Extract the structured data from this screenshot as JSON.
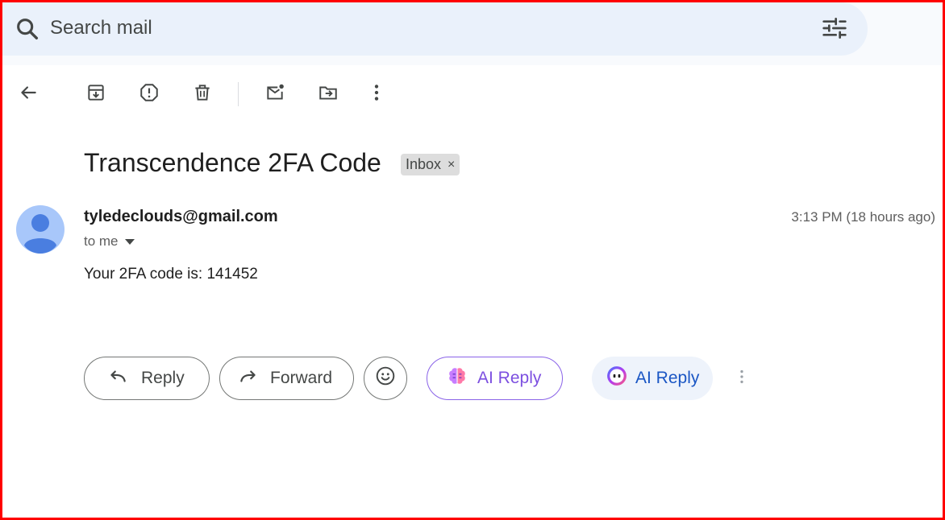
{
  "search": {
    "placeholder": "Search mail"
  },
  "toolbar": {
    "back": "arrow-back-icon",
    "archive": "archive-icon",
    "spam": "report-spam-icon",
    "delete": "delete-icon",
    "mark_unread": "mark-unread-icon",
    "move_to": "move-to-icon",
    "more": "more-vert-icon"
  },
  "email": {
    "subject": "Transcendence 2FA Code",
    "label": "Inbox",
    "label_remove": "×",
    "sender": "tyledeclouds@gmail.com",
    "recipient": "to me",
    "time": "3:13 PM (18 hours ago)",
    "body": "Your 2FA code is: 141452"
  },
  "actions": {
    "reply": "Reply",
    "forward": "Forward",
    "ai_reply_1": "AI Reply",
    "ai_reply_2": "AI Reply"
  },
  "colors": {
    "frame": "#ff0000",
    "search_bg": "#eaf1fb",
    "avatar": "#4a7ee0",
    "ai_purple": "#7c4fe0",
    "ai_blue": "#1a56c4"
  }
}
